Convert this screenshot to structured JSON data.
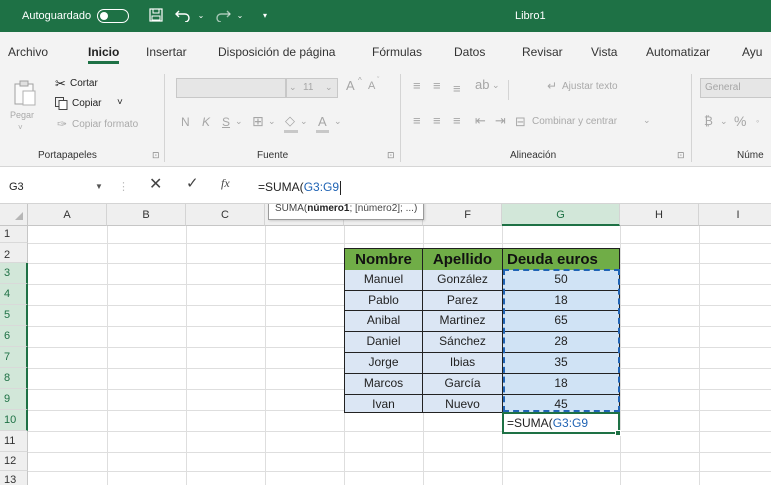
{
  "titlebar": {
    "autosave_label": "Autoguardado",
    "document_title": "Libro1",
    "undo_dropdown": "⌄",
    "redo_dropdown": "⌄",
    "more_commands": "▾"
  },
  "menu_tabs": [
    "Archivo",
    "Inicio",
    "Insertar",
    "Disposición de página",
    "Fórmulas",
    "Datos",
    "Revisar",
    "Vista",
    "Automatizar",
    "Ayu"
  ],
  "ribbon": {
    "clipboard": {
      "paste_label": "Pegar",
      "cut_label": "Cortar",
      "copy_label": "Copiar",
      "copy_dropdown": "˅",
      "format_painter_label": "Copiar formato",
      "group_label": "Portapapeles"
    },
    "font": {
      "font_size": "11",
      "grow": "A",
      "shrink": "A",
      "bold": "N",
      "italic": "K",
      "underline": "S",
      "font_color": "A",
      "group_label": "Fuente"
    },
    "alignment": {
      "wrap_label": "Ajustar texto",
      "merge_label": "Combinar y centrar",
      "group_label": "Alineación"
    },
    "number": {
      "format_value": "General",
      "percent": "%",
      "group_label": "Núme"
    }
  },
  "formula_bar": {
    "name_box": "G3",
    "fx_label": "fx",
    "formula_prefix": "=SUMA(",
    "formula_ref": "G3:G9"
  },
  "tooltip": {
    "fn": "SUMA(",
    "arg1": "número1",
    "rest": "; [número2]; ...)"
  },
  "columns": [
    "A",
    "B",
    "C",
    "D",
    "F",
    "G",
    "H",
    "I"
  ],
  "rows": [
    "1",
    "2",
    "3",
    "4",
    "5",
    "6",
    "7",
    "8",
    "9",
    "10",
    "11",
    "12",
    "13"
  ],
  "table": {
    "headers": [
      "Nombre",
      "Apellido",
      "Deuda euros"
    ],
    "rows": [
      [
        "Manuel",
        "González",
        "50"
      ],
      [
        "Pablo",
        "Parez",
        "18"
      ],
      [
        "Anibal",
        "Martinez",
        "65"
      ],
      [
        "Daniel",
        "Sánchez",
        "28"
      ],
      [
        "Jorge",
        "Ibias",
        "35"
      ],
      [
        "Marcos",
        "García",
        "18"
      ],
      [
        "Ivan",
        "Nuevo",
        "45"
      ]
    ]
  },
  "active_cell": {
    "content_prefix": "=SUMA(",
    "content_ref": "G3:G9"
  },
  "colors": {
    "excel_green": "#1e7145",
    "header_fill": "#70ad47",
    "table_fill": "#dbe6f4",
    "selection_blue": "#1f63b4"
  }
}
